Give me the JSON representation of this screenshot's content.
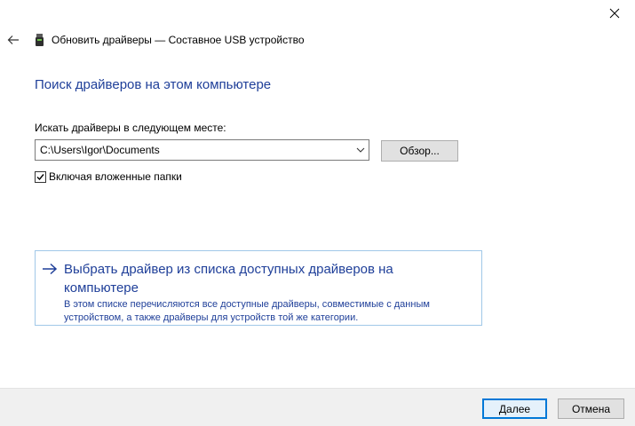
{
  "window": {
    "title": "Обновить драйверы — Составное USB устройство"
  },
  "heading": "Поиск драйверов на этом компьютере",
  "search": {
    "label": "Искать драйверы в следующем месте:",
    "path_value": "C:\\Users\\Igor\\Documents",
    "browse_label": "Обзор...",
    "subfolders_label": "Включая вложенные папки",
    "subfolders_checked": true
  },
  "pick_option": {
    "title": "Выбрать драйвер из списка доступных драйверов на компьютере",
    "description": "В этом списке перечисляются все доступные драйверы, совместимые с данным устройством, а также драйверы для устройств той же категории."
  },
  "footer": {
    "next_label": "Далее",
    "cancel_label": "Отмена"
  },
  "colors": {
    "accent": "#1f3f99",
    "focus_border": "#0078d7",
    "footer_bg": "#f0f0f0"
  }
}
